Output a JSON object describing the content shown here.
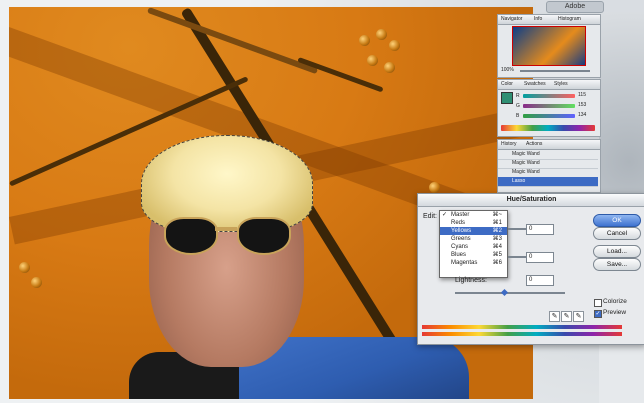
{
  "app": {
    "top_tab_label": "Adobe"
  },
  "navigator": {
    "tabs": [
      "Navigator",
      "Info",
      "Histogram"
    ],
    "zoom": "100%"
  },
  "color_palette": {
    "tabs": [
      "Color",
      "Swatches",
      "Styles"
    ],
    "channels": [
      {
        "label": "R",
        "value": "115"
      },
      {
        "label": "G",
        "value": "153"
      },
      {
        "label": "B",
        "value": "134"
      }
    ]
  },
  "history_palette": {
    "tabs": [
      "History",
      "Actions"
    ],
    "items": [
      "Magic Wand",
      "Magic Wand",
      "Magic Wand",
      "Lasso"
    ],
    "selected_index": 3
  },
  "hue_saturation": {
    "title": "Hue/Saturation",
    "edit_label": "Edit:",
    "menu": [
      {
        "label": "Master",
        "shortcut": "⌘~",
        "checked": true
      },
      {
        "label": "Reds",
        "shortcut": "⌘1"
      },
      {
        "label": "Yellows",
        "shortcut": "⌘2",
        "selected": true
      },
      {
        "label": "Greens",
        "shortcut": "⌘3"
      },
      {
        "label": "Cyans",
        "shortcut": "⌘4"
      },
      {
        "label": "Blues",
        "shortcut": "⌘5"
      },
      {
        "label": "Magentas",
        "shortcut": "⌘6"
      }
    ],
    "fields": [
      "0",
      "0",
      "0"
    ],
    "lightness_label": "Lightness:",
    "buttons": {
      "ok": "OK",
      "cancel": "Cancel",
      "load": "Load...",
      "save": "Save..."
    },
    "colorize_label": "Colorize",
    "preview_label": "Preview",
    "colorize_checked": false,
    "preview_checked": true
  },
  "colors": {
    "accent": "#3d6bc4"
  }
}
